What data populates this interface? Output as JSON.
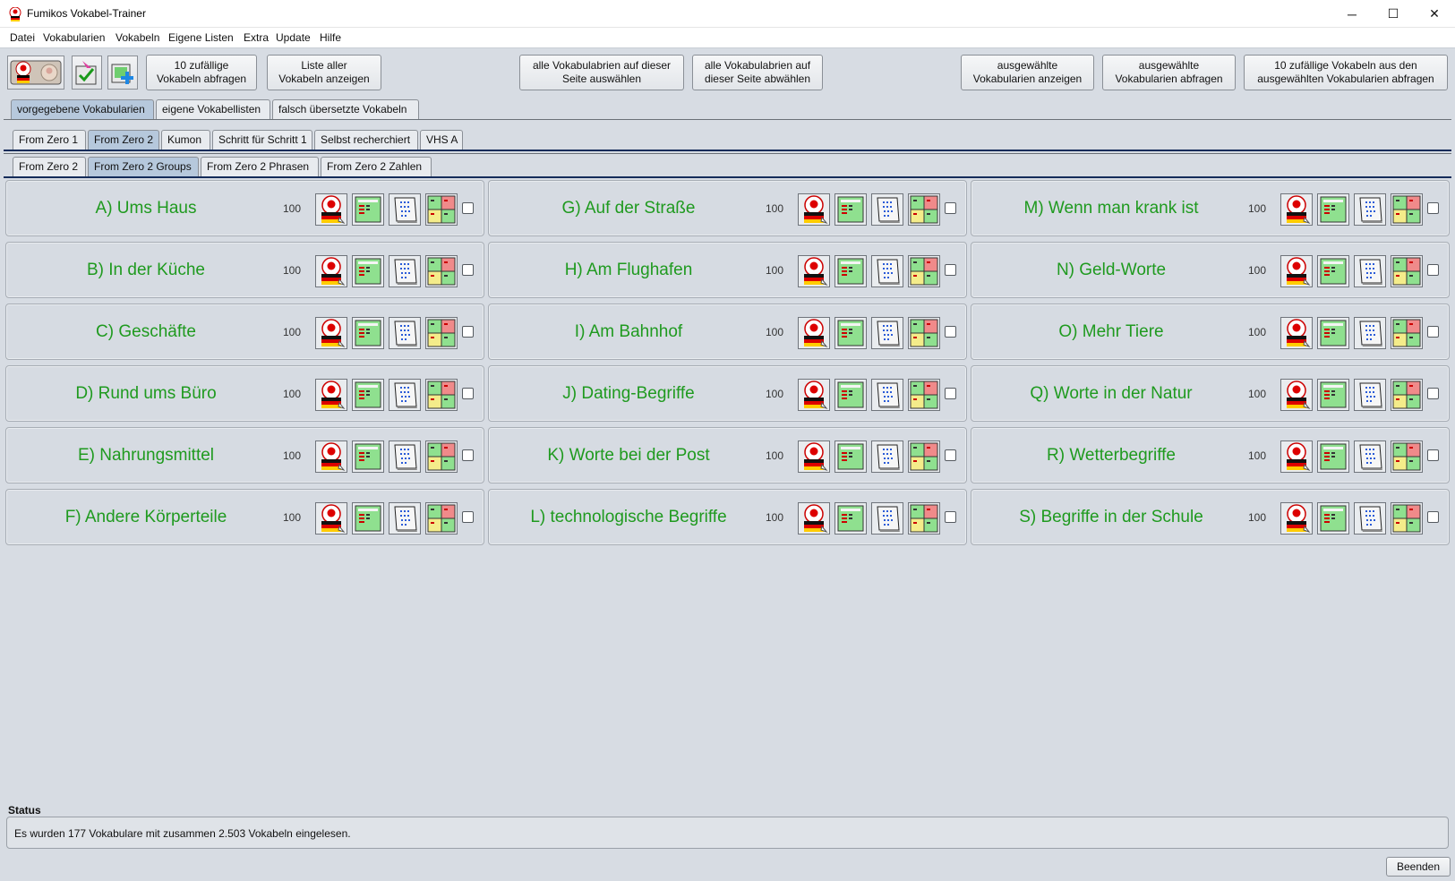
{
  "window": {
    "title": "Fumikos Vokabel-Trainer",
    "controls": {
      "minimize": "─",
      "maximize": "☐",
      "close": "✕"
    }
  },
  "menu": [
    "Datei",
    "Vokabularien",
    "Vokabeln",
    "Eigene Listen",
    "Extra",
    "Update",
    "Hilfe"
  ],
  "toolbar": {
    "icon_buttons": [
      "japanese-german-icon",
      "check-arrow-icon",
      "add-list-icon"
    ],
    "random_ten": "10 zufällige\nVokabeln abfragen",
    "list_all": "Liste aller\nVokabeln anzeigen",
    "select_all": "alle Vokabulabrien auf dieser\nSeite auswählen",
    "deselect_all": "alle Vokabulabrien auf\ndieser Seite abwählen",
    "show_selected": "ausgewählte\nVokabularien anzeigen",
    "quiz_selected": "ausgewählte\nVokabularien abfragen",
    "random_ten_selected": "10 zufällige Vokabeln aus den\nausgewählten Vokabularien abfragen"
  },
  "main_tabs": [
    "vorgegebene Vokabularien",
    "eigene Vokabellisten",
    "falsch übersetzte Vokabeln"
  ],
  "main_tab_active": 0,
  "course_tabs": [
    "From Zero 1",
    "From Zero 2",
    "Kumon",
    "Schritt für Schritt 1",
    "Selbst recherchiert",
    "VHS A"
  ],
  "course_tab_active": 1,
  "sub_tabs": [
    "From Zero 2",
    "From Zero 2 Groups",
    "From Zero 2 Phrasen",
    "From Zero 2 Zahlen"
  ],
  "sub_tab_active": 1,
  "vocab_lists": [
    {
      "name": "A) Ums Haus",
      "count": "100",
      "checked": false
    },
    {
      "name": "B) In der Küche",
      "count": "100",
      "checked": false
    },
    {
      "name": "C) Geschäfte",
      "count": "100",
      "checked": false
    },
    {
      "name": "D) Rund ums Büro",
      "count": "100",
      "checked": false
    },
    {
      "name": "E) Nahrungsmittel",
      "count": "100",
      "checked": false
    },
    {
      "name": "F) Andere Körperteile",
      "count": "100",
      "checked": false
    },
    {
      "name": "G) Auf der Straße",
      "count": "100",
      "checked": false
    },
    {
      "name": "H) Am Flughafen",
      "count": "100",
      "checked": false
    },
    {
      "name": "I) Am Bahnhof",
      "count": "100",
      "checked": false
    },
    {
      "name": "J) Dating-Begriffe",
      "count": "100",
      "checked": false
    },
    {
      "name": "K) Worte bei der Post",
      "count": "100",
      "checked": false
    },
    {
      "name": "L) technologische Begriffe",
      "count": "100",
      "checked": false
    },
    {
      "name": "M) Wenn man krank ist",
      "count": "100",
      "checked": false
    },
    {
      "name": "N) Geld-Worte",
      "count": "100",
      "checked": false
    },
    {
      "name": "O) Mehr Tiere",
      "count": "100",
      "checked": false
    },
    {
      "name": "Q) Worte in der Natur",
      "count": "100",
      "checked": false
    },
    {
      "name": "R) Wetterbegriffe",
      "count": "100",
      "checked": false
    },
    {
      "name": "S) Begriffe in der Schule",
      "count": "100",
      "checked": false
    }
  ],
  "card_icons": [
    "quiz-jp-de-icon",
    "vocab-table-icon",
    "notebook-icon",
    "grid-stats-icon"
  ],
  "colors": {
    "vocab_name": "#1f9a1f",
    "active_tab": "#b6c8dc",
    "background": "#d7dce3"
  },
  "status": {
    "label": "Status",
    "message": "Es wurden 177 Vokabulare mit zusammen 2.503 Vokabeln eingelesen."
  },
  "quit_button": "Beenden"
}
